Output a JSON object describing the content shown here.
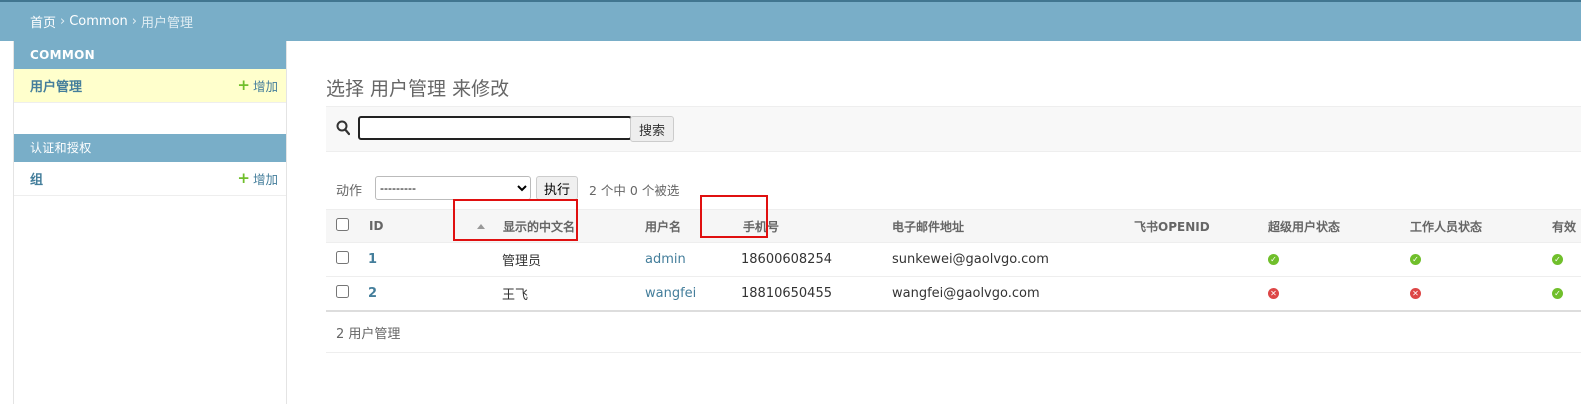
{
  "breadcrumb": {
    "home": "首页",
    "sep": "›",
    "app": "Common",
    "current": "用户管理"
  },
  "sidebar": {
    "modules": [
      {
        "caption": "COMMON",
        "models": [
          {
            "label": "用户管理",
            "add": "增加"
          }
        ]
      },
      {
        "caption": "认证和授权",
        "models": [
          {
            "label": "组",
            "add": "增加"
          }
        ]
      }
    ]
  },
  "page": {
    "title": "选择 用户管理 来修改"
  },
  "search": {
    "value": "",
    "button": "搜索"
  },
  "actions": {
    "label": "动作",
    "selected_option": "---------",
    "run": "执行",
    "counter": "2 个中 0 个被选"
  },
  "table": {
    "headers": [
      "ID",
      "显示的中文名",
      "用户名",
      "手机号",
      "电子邮件地址",
      "飞书OPENID",
      "超级用户状态",
      "工作人员状态",
      "有效"
    ],
    "rows": [
      {
        "id": "1",
        "display_name": "管理员",
        "username": "admin",
        "phone": "18600608254",
        "email": "sunkewei@gaolvgo.com",
        "feishu": "",
        "superuser": true,
        "staff": true,
        "active": true
      },
      {
        "id": "2",
        "display_name": "王飞",
        "username": "wangfei",
        "phone": "18810650455",
        "email": "wangfei@gaolvgo.com",
        "feishu": "",
        "superuser": false,
        "staff": false,
        "active": true
      }
    ]
  },
  "paginator": {
    "text": "2 用户管理"
  },
  "colors": {
    "header_bg": "#79aec8",
    "link": "#447e9b",
    "highlight_red": "#e01010",
    "yes_green": "#70bf2b",
    "no_red": "#dd4646"
  }
}
